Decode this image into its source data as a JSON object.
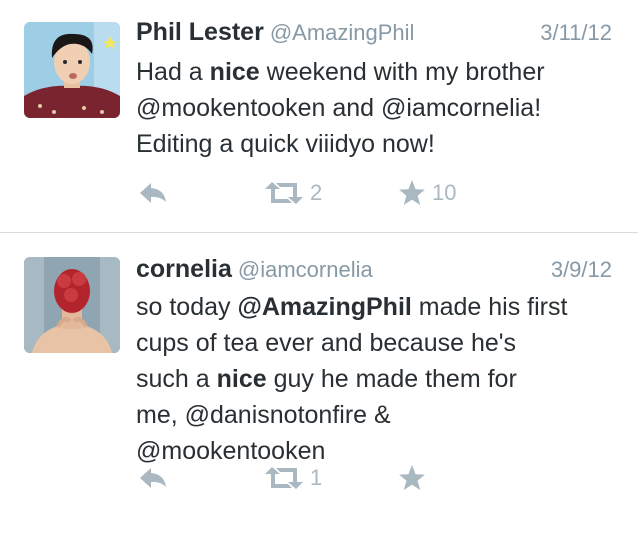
{
  "tweets": [
    {
      "name": "Phil Lester",
      "handle": "@AmazingPhil",
      "date": "3/11/12",
      "text_parts": [
        "Had a ",
        "nice",
        " weekend with my brother",
        "@mookentooken and @iamcornelia!",
        "Editing a quick viiidyo now!"
      ],
      "retweets": "2",
      "favorites": "10"
    },
    {
      "name": "cornelia",
      "handle": "@iamcornelia",
      "date": "3/9/12",
      "text_parts": [
        "so today ",
        "@AmazingPhil",
        " made his first",
        "cups of tea ever and because he's",
        "such a ",
        "nice",
        " guy he made them for",
        "me, @danisnotonfire &",
        "@mookentooken"
      ],
      "retweets": "1",
      "favorites": ""
    }
  ],
  "colors": {
    "icon": "#aab8c2",
    "handle": "#8899a6",
    "text": "#292f33",
    "divider": "#d9d9d9"
  },
  "icons": [
    "reply-icon",
    "retweet-icon",
    "favorite-icon"
  ]
}
